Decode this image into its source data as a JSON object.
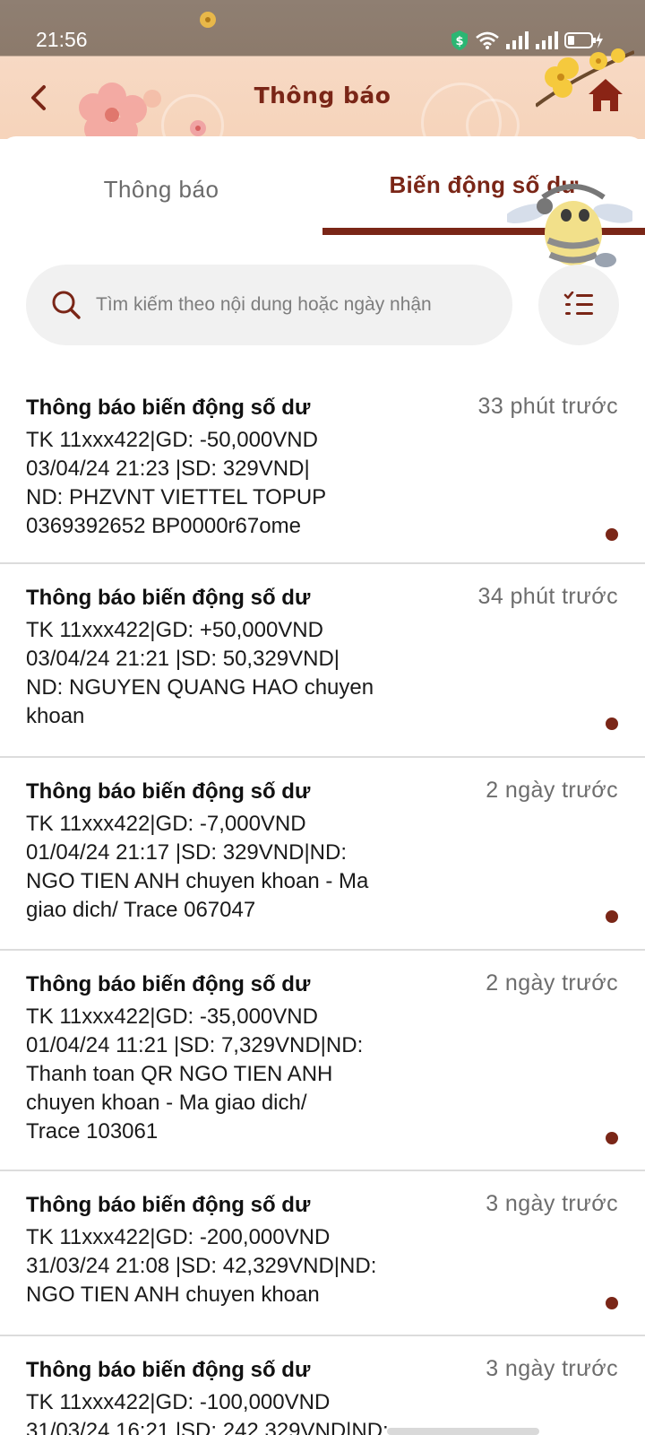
{
  "status_bar": {
    "time": "21:56"
  },
  "header": {
    "title": "Thông báo",
    "icons": {
      "back": "chevron-left-icon",
      "home": "home-icon"
    }
  },
  "tabs": [
    {
      "label": "Thông báo",
      "active": false
    },
    {
      "label": "Biến động số dư",
      "active": true
    }
  ],
  "search": {
    "placeholder": "Tìm kiếm theo nội dung hoặc ngày nhận",
    "value": ""
  },
  "colors": {
    "brand": "#7a2617",
    "unread_dot": "#7a2617",
    "search_bg": "#f1f1f1"
  },
  "notifications": [
    {
      "title": "Thông báo biến động số dư",
      "time": "33 phút trước",
      "body": "TK 11xxx422|GD: -50,000VND\n03/04/24 21:23 |SD: 329VND|\nND: PHZVNT VIETTEL TOPUP\n0369392652 BP0000r67ome",
      "unread": true
    },
    {
      "title": "Thông báo biến động số dư",
      "time": "34 phút trước",
      "body": "TK 11xxx422|GD: +50,000VND\n03/04/24 21:21 |SD: 50,329VND|\nND: NGUYEN QUANG HAO chuyen\nkhoan",
      "unread": true
    },
    {
      "title": "Thông báo biến động số dư",
      "time": "2 ngày trước",
      "body": "TK 11xxx422|GD: -7,000VND\n01/04/24 21:17 |SD: 329VND|ND:\nNGO TIEN ANH chuyen khoan - Ma\ngiao dich/ Trace 067047",
      "unread": true
    },
    {
      "title": "Thông báo biến động số dư",
      "time": "2 ngày trước",
      "body": "TK 11xxx422|GD: -35,000VND\n01/04/24 11:21 |SD: 7,329VND|ND:\nThanh toan QR NGO TIEN ANH\nchuyen khoan - Ma giao dich/\nTrace 103061",
      "unread": true
    },
    {
      "title": "Thông báo biến động số dư",
      "time": "3 ngày trước",
      "body": "TK 11xxx422|GD: -200,000VND\n31/03/24 21:08 |SD: 42,329VND|ND:\nNGO TIEN ANH chuyen khoan",
      "unread": true
    },
    {
      "title": "Thông báo biến động số dư",
      "time": "3 ngày trước",
      "body": "TK 11xxx422|GD: -100,000VND\n31/03/24 16:21 |SD: 242,329VND|ND:",
      "unread": false
    }
  ]
}
